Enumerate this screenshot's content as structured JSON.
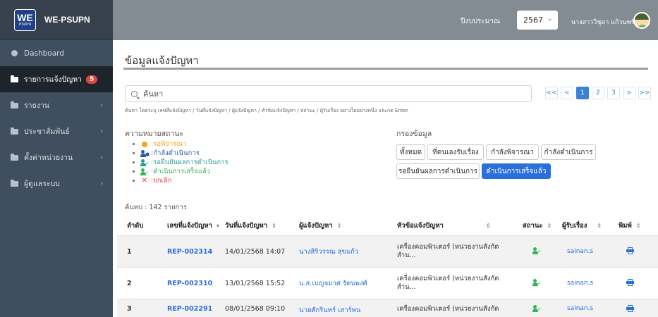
{
  "brand": {
    "logo_top": "WE",
    "logo_bottom": "PSUPN",
    "name": "WE-PSUPN"
  },
  "sidebar": {
    "items": [
      {
        "label": "Dashboard",
        "icon": "dashboard-icon",
        "active": false
      },
      {
        "label": "รายการแจ้งปัญหา",
        "icon": "folder-icon",
        "active": true,
        "badge": "5"
      },
      {
        "label": "รายงาน",
        "icon": "folder-icon",
        "active": false
      },
      {
        "label": "ประชาสัมพันธ์",
        "icon": "folder-icon",
        "active": false
      },
      {
        "label": "ตั้งค่าหน่วยงาน",
        "icon": "folder-icon",
        "active": false
      },
      {
        "label": "ผู้ดูแลระบบ",
        "icon": "folder-icon",
        "active": false
      }
    ]
  },
  "topbar": {
    "year_label": "ปีงบประมาณ",
    "year_value": "2567",
    "user_name": "นางสาววิชุดา แก้วนพรัตน์"
  },
  "main": {
    "title": "ข้อมูลแจ้งปัญหา",
    "search_placeholder": "ค้นหา",
    "search_help": "ค้นหา โดยระบุ เลขที่แจ้งปัญหา / วันที่แจ้งปัญหา / ผู้แจ้งปัญหา / หัวข้อแจ้งปัญหา / สถานะ / ผู้รับเรื่อง อย่างใดอย่างหนึ่ง และกด Enter",
    "pager": [
      "<<",
      "<",
      "1",
      "2",
      "3",
      ">",
      ">>"
    ],
    "pager_active": "1",
    "legend_title": "ความหมายสถานะ",
    "legend": [
      {
        "icon": "coin-icon",
        "text": ":รอพิจารณา",
        "color": "#f3a51b"
      },
      {
        "icon": "user-cog-icon",
        "text": ":กำลังดำเนินการ",
        "color": "#2c5aa0"
      },
      {
        "icon": "user-check-icon",
        "text": ":รอยืนยันผลการดำเนินการ",
        "color": "#2a9d8f"
      },
      {
        "icon": "user-check-icon",
        "text": ":ดำเนินการเสร็จแล้ว",
        "color": "#35b35a"
      },
      {
        "icon": "x-icon",
        "text": ":ยกเลิก",
        "color": "#e2463b"
      }
    ],
    "filter_title": "กรองข้อมูล",
    "filters": {
      "all": "ทั้งหมด",
      "mine": "ที่ตนเองรับเรื่อง",
      "considering": "กำลังพิจารณา",
      "in_progress": "กำลังดำเนินการ",
      "awaiting_confirm": "รอยืนยันผลการดำเนินการ",
      "done": "ดำเนินการเสร็จแล้ว"
    },
    "found": "ค้นพบ : 142 รายการ",
    "table": {
      "headers": [
        "ลำดับ",
        "เลขที่แจ้งปัญหา",
        "วันที่แจ้งปัญหา",
        "ผู้แจ้งปัญหา",
        "หัวข้อแจ้งปัญหา",
        "สถานะ",
        "ผู้รับเรื่อง",
        "พิมพ์"
      ],
      "rows": [
        {
          "no": "1",
          "id": "REP-002314",
          "date": "14/01/2568 14:07",
          "reporter": "นางสิริวรรณ สุขแก้ว",
          "subject_1": "เครื่องคอมพิวเตอร์ (หน่วยงานสังกัด",
          "subject_2": "สำน...",
          "status_icon": "user-check-icon",
          "assignee": "sainan.s"
        },
        {
          "no": "2",
          "id": "REP-002310",
          "date": "13/01/2568 15:52",
          "reporter": "น.ส.เบญจมาศ รัตนพงศ์",
          "subject_1": "เครื่องคอมพิวเตอร์ (หน่วยงานสังกัด",
          "subject_2": "สำน...",
          "status_icon": "user-check-icon",
          "assignee": "sainan.s"
        },
        {
          "no": "3",
          "id": "REP-002291",
          "date": "08/01/2568 09:10",
          "reporter": "นายศักรินทร์ เสาร์พน",
          "subject_1": "เครื่องคอมพิวเตอร์ (หน่วยงานสังกัด",
          "subject_2": "",
          "status_icon": "user-check-icon",
          "assignee": "sainan.s"
        }
      ]
    }
  }
}
